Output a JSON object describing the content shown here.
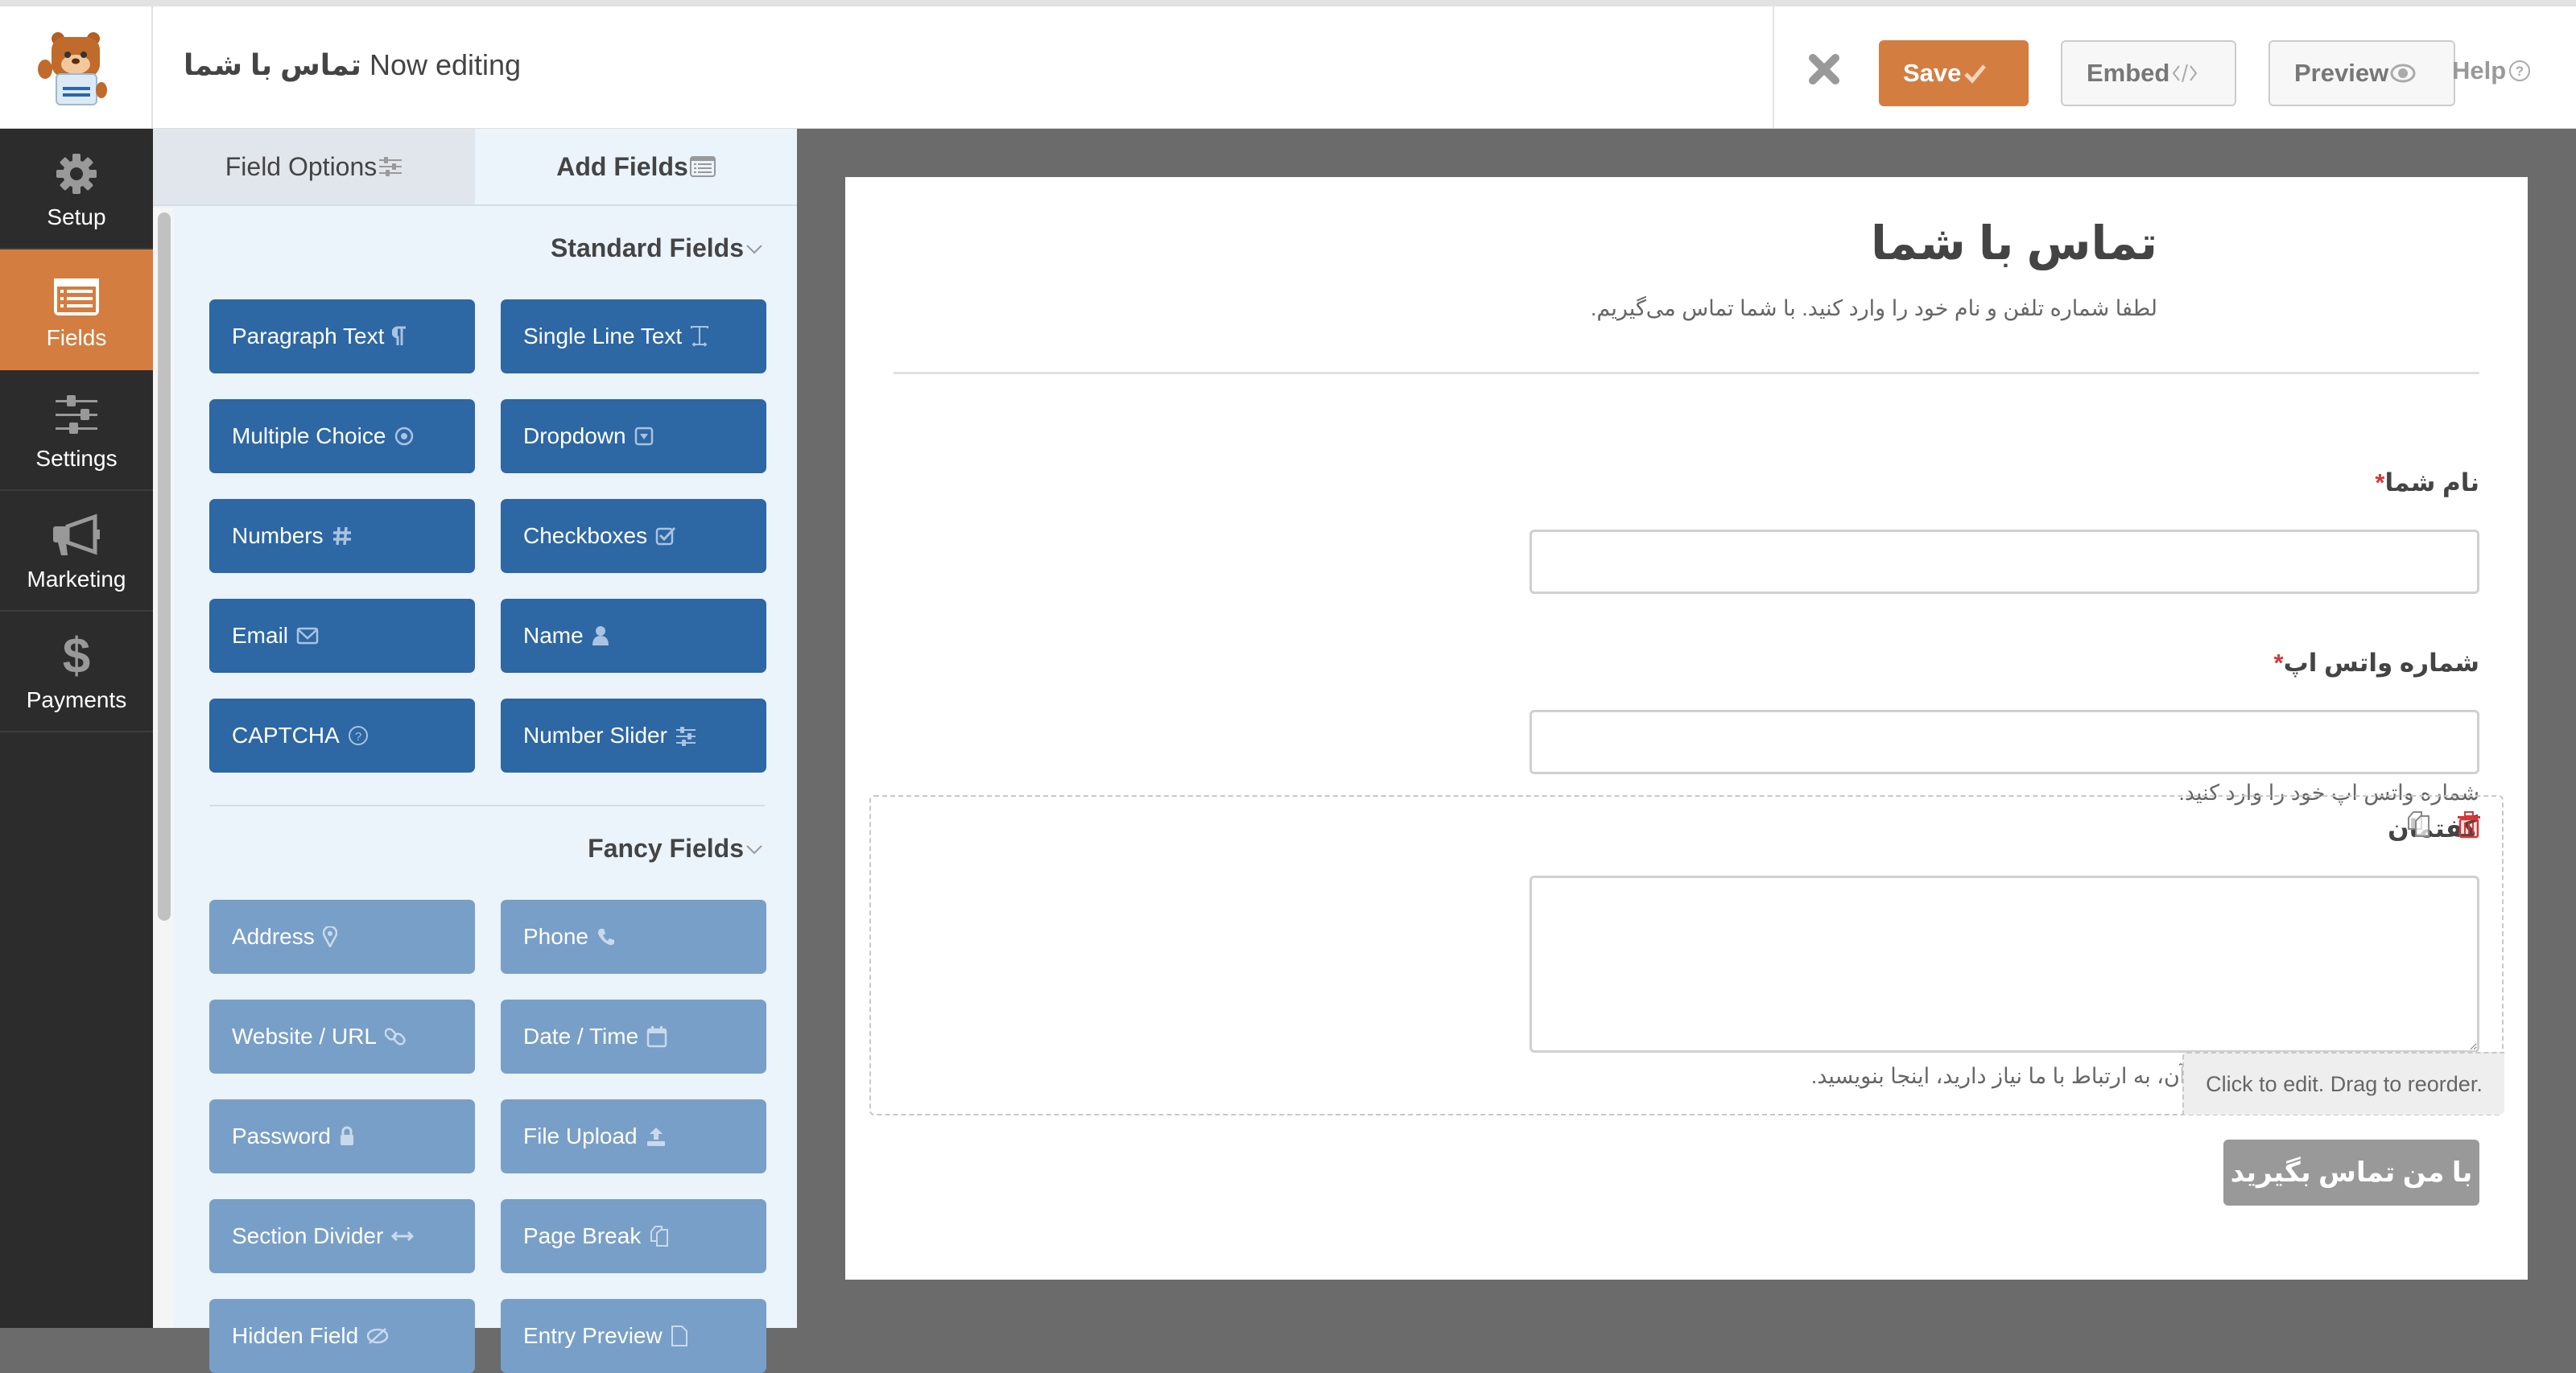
{
  "header": {
    "form_name": "تماس با شما",
    "now_editing_label": "Now editing",
    "save_label": "Save",
    "embed_label": "Embed",
    "preview_label": "Preview",
    "help_label": "Help",
    "icons": {
      "close": "close-icon",
      "save": "check-icon",
      "embed": "code-icon",
      "preview": "eye-icon",
      "help": "question-circle-icon"
    }
  },
  "nav": {
    "items": [
      {
        "label": "Setup",
        "icon": "gear-icon",
        "active": false
      },
      {
        "label": "Fields",
        "icon": "list-icon",
        "active": true
      },
      {
        "label": "Settings",
        "icon": "sliders-icon",
        "active": false
      },
      {
        "label": "Marketing",
        "icon": "megaphone-icon",
        "active": false
      },
      {
        "label": "Payments",
        "icon": "dollar-icon",
        "active": false
      }
    ]
  },
  "panel": {
    "tabs": [
      {
        "label": "Field Options",
        "icon": "sliders-icon",
        "active": false
      },
      {
        "label": "Add Fields",
        "icon": "list-icon",
        "active": true
      }
    ],
    "standard_group": {
      "title": "Standard Fields",
      "fields": [
        {
          "label": "Paragraph Text",
          "icon": "paragraph-icon"
        },
        {
          "label": "Single Line Text",
          "icon": "text-cursor-icon"
        },
        {
          "label": "Multiple Choice",
          "icon": "radio-icon"
        },
        {
          "label": "Dropdown",
          "icon": "dropdown-icon"
        },
        {
          "label": "Numbers",
          "icon": "hash-icon"
        },
        {
          "label": "Checkboxes",
          "icon": "checkbox-icon"
        },
        {
          "label": "Email",
          "icon": "envelope-icon"
        },
        {
          "label": "Name",
          "icon": "user-icon"
        },
        {
          "label": "CAPTCHA",
          "icon": "question-circle-icon"
        },
        {
          "label": "Number Slider",
          "icon": "sliders-icon"
        }
      ]
    },
    "fancy_group": {
      "title": "Fancy Fields",
      "fields": [
        {
          "label": "Address",
          "icon": "map-pin-icon"
        },
        {
          "label": "Phone",
          "icon": "phone-icon"
        },
        {
          "label": "Website / URL",
          "icon": "link-icon"
        },
        {
          "label": "Date / Time",
          "icon": "calendar-icon"
        },
        {
          "label": "Password",
          "icon": "lock-icon"
        },
        {
          "label": "File Upload",
          "icon": "upload-icon"
        },
        {
          "label": "Section Divider",
          "icon": "arrows-h-icon"
        },
        {
          "label": "Page Break",
          "icon": "copy-icon"
        },
        {
          "label": "Hidden Field",
          "icon": "eye-slash-icon"
        },
        {
          "label": "Entry Preview",
          "icon": "file-icon"
        }
      ]
    }
  },
  "form": {
    "title": "تماس با شما",
    "description": "لطفا شماره تلفن و نام خود را وارد کنید. با شما تماس می‌گیریم.",
    "fields": [
      {
        "label": "نام شما",
        "required": true,
        "type": "text",
        "value": "",
        "description": ""
      },
      {
        "label": "شماره واتس اپ",
        "required": true,
        "type": "text",
        "value": "",
        "description": "شماره واتس اپ خود را وارد کنید."
      },
      {
        "label": "گفتمان",
        "required": false,
        "type": "textarea",
        "value": "",
        "description": "ی آن، به ارتباط با ما نیاز دارید، اینجا بنویسید.",
        "selected": true,
        "actions": [
          "duplicate-icon",
          "trash-icon"
        ]
      }
    ],
    "required_marker": "*",
    "edit_hint": "Click to edit. Drag to reorder.",
    "submit_label": "با من تماس بگیرید"
  },
  "colors": {
    "accent": "#d47d41",
    "standard_field": "#2d67a4",
    "fancy_field": "#789fc7",
    "nav_bg": "#2c2c2c",
    "required": "#d63638"
  }
}
